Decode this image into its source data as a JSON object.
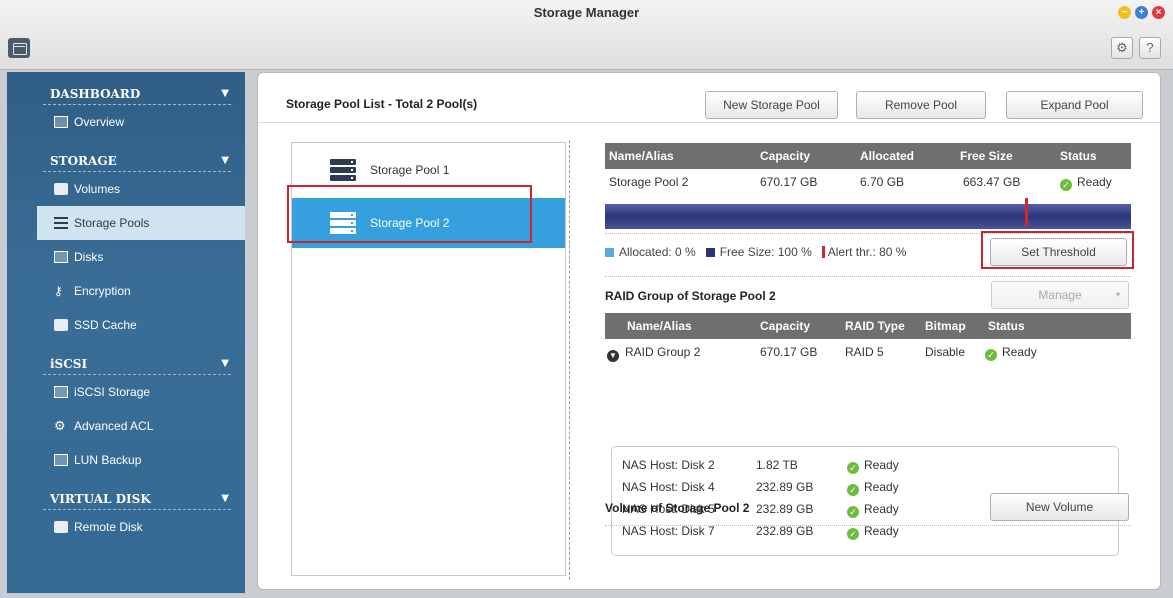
{
  "window": {
    "title": "Storage Manager"
  },
  "sidebar": {
    "sections": [
      {
        "label": "DASHBOARD",
        "items": [
          {
            "label": "Overview",
            "icon": "overview-icon"
          }
        ]
      },
      {
        "label": "STORAGE",
        "items": [
          {
            "label": "Volumes",
            "icon": "volumes-icon"
          },
          {
            "label": "Storage Pools",
            "icon": "storage-pools-icon",
            "active": true
          },
          {
            "label": "Disks",
            "icon": "disks-icon"
          },
          {
            "label": "Encryption",
            "icon": "key-icon"
          },
          {
            "label": "SSD Cache",
            "icon": "ssd-cache-icon"
          }
        ]
      },
      {
        "label": "iSCSI",
        "items": [
          {
            "label": "iSCSI Storage",
            "icon": "iscsi-storage-icon"
          },
          {
            "label": "Advanced ACL",
            "icon": "gear-icon"
          },
          {
            "label": "LUN Backup",
            "icon": "lun-backup-icon"
          }
        ]
      },
      {
        "label": "VIRTUAL DISK",
        "items": [
          {
            "label": "Remote Disk",
            "icon": "remote-disk-icon"
          }
        ]
      }
    ]
  },
  "main": {
    "header": "Storage Pool List - Total 2 Pool(s)",
    "buttons": {
      "new_pool": "New Storage Pool",
      "remove_pool": "Remove Pool",
      "expand_pool": "Expand Pool"
    },
    "pools": [
      "Storage Pool 1",
      "Storage Pool 2"
    ],
    "pool_table": {
      "columns": [
        "Name/Alias",
        "Capacity",
        "Allocated",
        "Free Size",
        "Status"
      ],
      "row": {
        "name": "Storage Pool 2",
        "capacity": "670.17 GB",
        "allocated": "6.70 GB",
        "free": "663.47 GB",
        "status": "Ready"
      }
    },
    "usage": {
      "allocated_fraction": 0.0,
      "alert_threshold_fraction": 0.8
    },
    "legend": {
      "allocated": "Allocated: 0 %",
      "free": "Free Size: 100 %",
      "alert": "Alert thr.: 80 %"
    },
    "set_threshold": "Set Threshold",
    "raid": {
      "title": "RAID Group of Storage Pool 2",
      "manage": "Manage",
      "columns": [
        "Name/Alias",
        "Capacity",
        "RAID Type",
        "Bitmap",
        "Status"
      ],
      "group": {
        "name": "RAID Group 2",
        "capacity": "670.17 GB",
        "raid_type": "RAID 5",
        "bitmap": "Disable",
        "status": "Ready"
      },
      "disks": [
        {
          "name": "NAS Host: Disk 2",
          "size": "1.82 TB",
          "status": "Ready"
        },
        {
          "name": "NAS Host: Disk 4",
          "size": "232.89 GB",
          "status": "Ready"
        },
        {
          "name": "NAS Host: Disk 5",
          "size": "232.89 GB",
          "status": "Ready"
        },
        {
          "name": "NAS Host: Disk 7",
          "size": "232.89 GB",
          "status": "Ready"
        }
      ]
    },
    "volume": {
      "title": "Volume of Storage Pool 2",
      "new_volume": "New Volume"
    }
  },
  "colors": {
    "sidebar": "#336a93",
    "selected": "#35a0dd",
    "highlight": "#c8282d",
    "capacity_bar": "#2a3478",
    "ready": "#6cbd3c"
  }
}
